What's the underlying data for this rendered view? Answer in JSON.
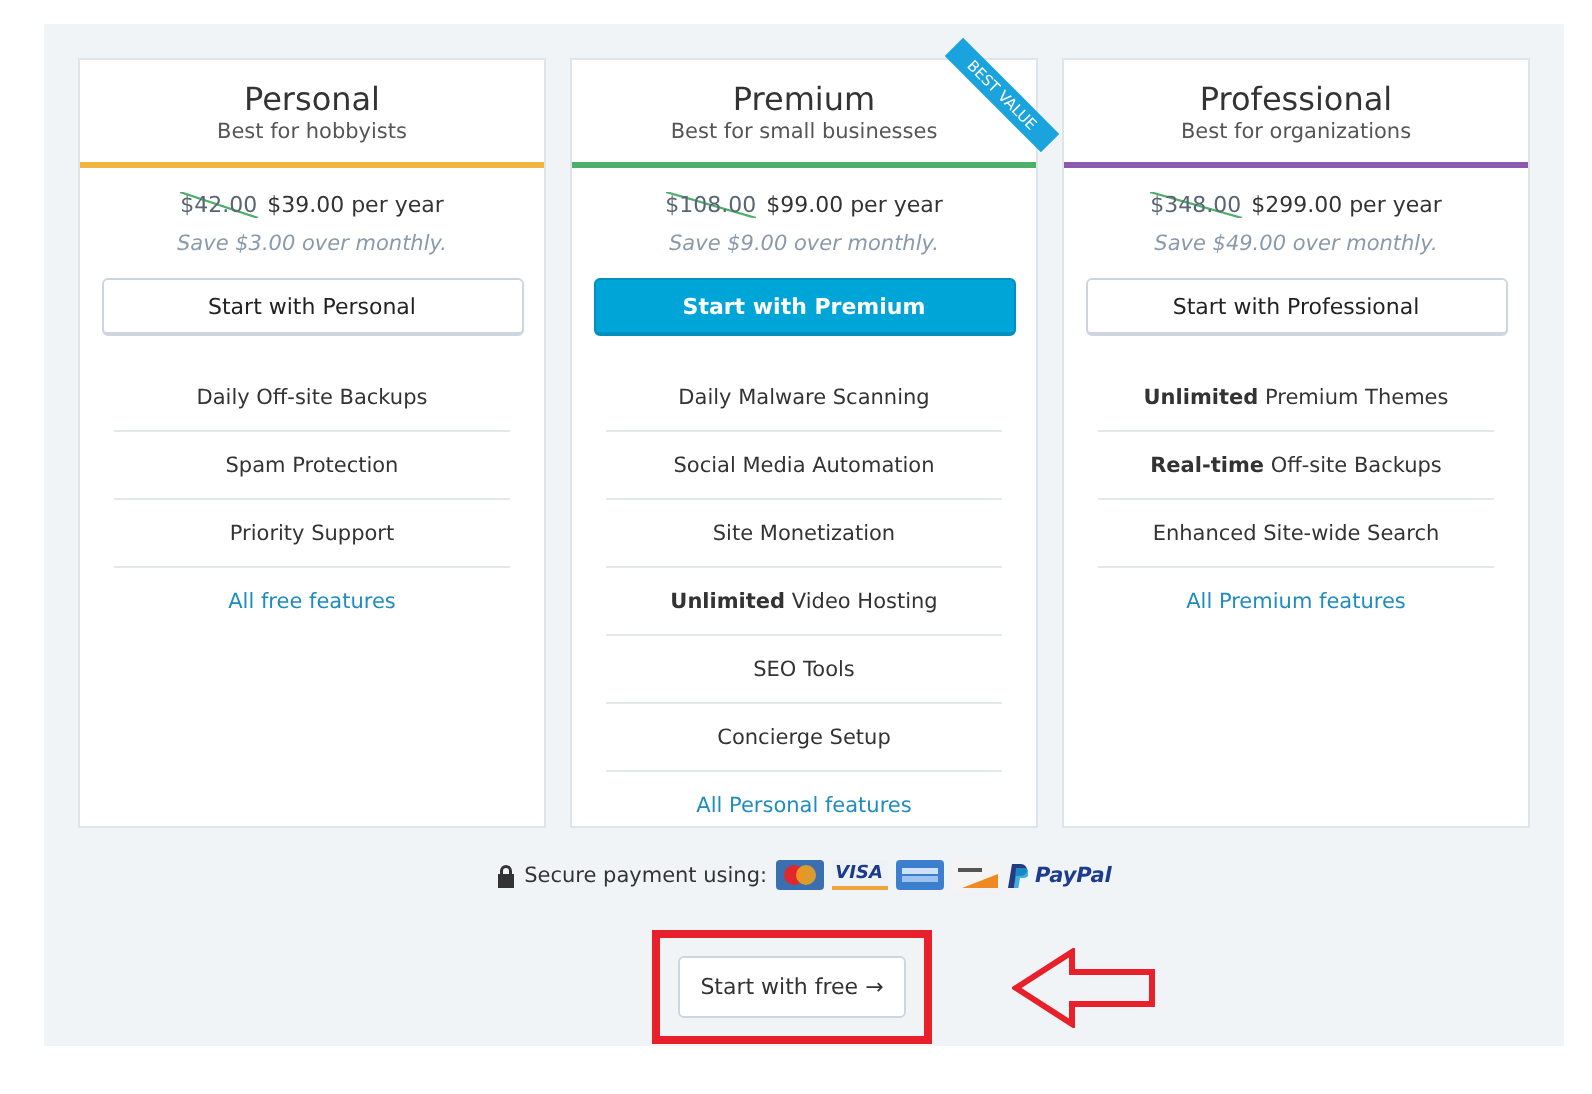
{
  "plans": [
    {
      "name": "Personal",
      "tagline": "Best for hobbyists",
      "color": "#f0b53f",
      "old_price": "$42.00",
      "price": "$39.00 per year",
      "savings": "Save $3.00 over monthly.",
      "button": "Start with Personal",
      "primary": false,
      "features": [
        "Daily Off-site Backups",
        "Spam Protection",
        "Priority Support"
      ],
      "link": "All free features"
    },
    {
      "name": "Premium",
      "tagline": "Best for small businesses",
      "color": "#4caf6a",
      "ribbon": "BEST VALUE",
      "old_price": "$108.00",
      "price": "$99.00 per year",
      "savings": "Save $9.00 over monthly.",
      "button": "Start with Premium",
      "primary": true,
      "features": [
        "Daily Malware Scanning",
        "Social Media Automation",
        "Site Monetization",
        "**Unlimited** Video Hosting",
        "SEO Tools",
        "Concierge Setup"
      ],
      "link": "All Personal features"
    },
    {
      "name": "Professional",
      "tagline": "Best for organizations",
      "color": "#8a5bb0",
      "old_price": "$348.00",
      "price": "$299.00 per year",
      "savings": "Save $49.00 over monthly.",
      "button": "Start with Professional",
      "primary": false,
      "features": [
        "**Unlimited** Premium Themes",
        "**Real-time** Off-site Backups",
        "Enhanced Site-wide Search"
      ],
      "link": "All Premium features"
    }
  ],
  "payment": {
    "label": "Secure payment using:",
    "visa": "VISA",
    "paypal": "PayPal"
  },
  "free_button": {
    "label": "Start with free",
    "arrow": "→",
    "highlighted": true
  }
}
